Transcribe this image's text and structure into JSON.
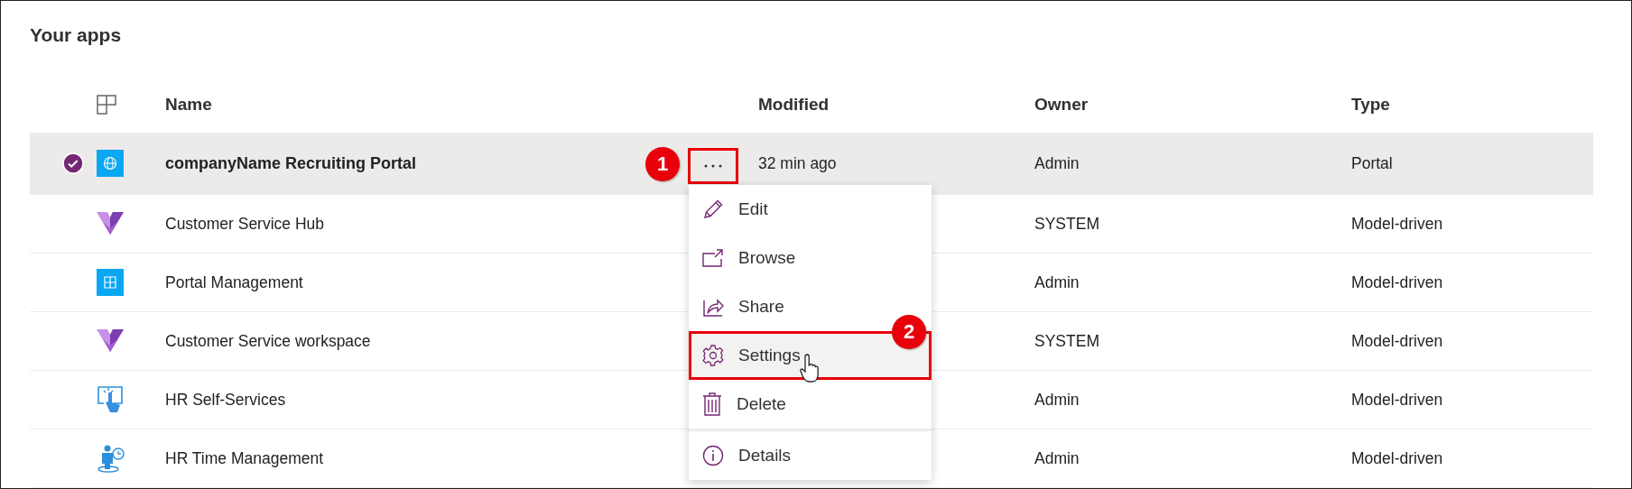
{
  "title": "Your apps",
  "columns": [
    {
      "kind": "icon"
    },
    {
      "kind": "text",
      "label": "Name"
    },
    {
      "kind": "text",
      "label": "Modified"
    },
    {
      "kind": "text",
      "label": "Owner"
    },
    {
      "kind": "text",
      "label": "Type"
    }
  ],
  "rows": [
    {
      "kind": "globe",
      "name": "companyName Recruiting Portal",
      "modified": "32 min ago",
      "owner": "Admin",
      "type": "Portal",
      "selected": true,
      "more_highlighted": true,
      "callout": "1"
    },
    {
      "kind": "heart",
      "name": "Customer Service Hub",
      "owner": "SYSTEM",
      "type": "Model-driven",
      "selected": false
    },
    {
      "kind": "grid",
      "name": "Portal Management",
      "owner": "Admin",
      "type": "Model-driven",
      "selected": false
    },
    {
      "kind": "heart",
      "name": "Customer Service workspace",
      "owner": "SYSTEM",
      "type": "Model-driven",
      "selected": false
    },
    {
      "kind": "touch",
      "name": "HR Self-Services",
      "owner": "Admin",
      "type": "Model-driven",
      "selected": false
    },
    {
      "kind": "person-clock",
      "name": "HR Time Management",
      "owner": "Admin",
      "type": "Model-driven",
      "selected": false
    }
  ],
  "menu": {
    "groups": [
      [
        {
          "kind": "pencil",
          "label": "Edit",
          "highlighted": false
        },
        {
          "kind": "open",
          "label": "Browse",
          "highlighted": false
        },
        {
          "kind": "share",
          "label": "Share",
          "highlighted": false
        },
        {
          "kind": "gear",
          "label": "Settings",
          "highlighted": true,
          "callout": "2"
        },
        {
          "kind": "trash",
          "label": "Delete",
          "highlighted": false
        }
      ],
      [
        {
          "kind": "info",
          "label": "Details",
          "highlighted": false
        }
      ]
    ]
  }
}
